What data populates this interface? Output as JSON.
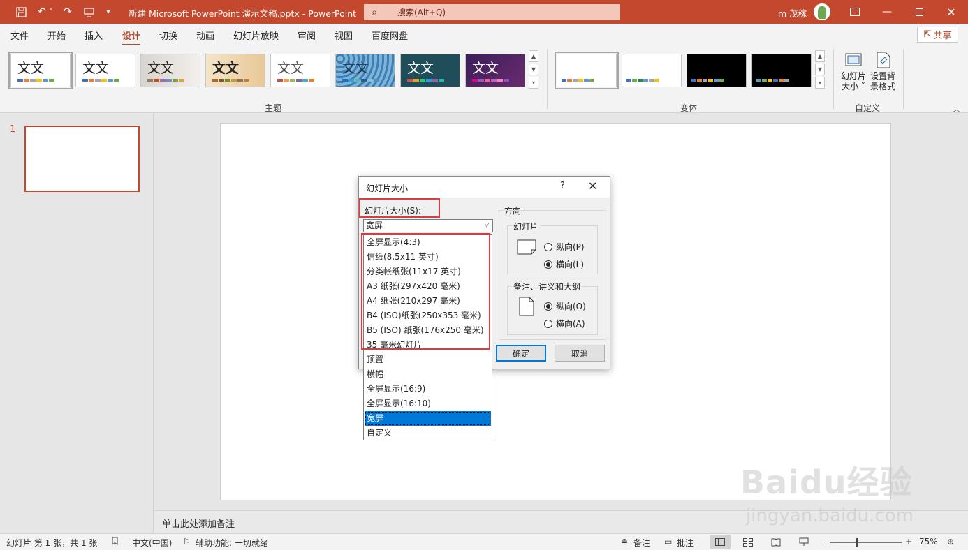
{
  "title_bar": {
    "doc_title": "新建 Microsoft PowerPoint 演示文稿.pptx  -  PowerPoint",
    "search_placeholder": "搜索(Alt+Q)",
    "user_name": "m 茂稼"
  },
  "ribbon_tabs": [
    "文件",
    "开始",
    "插入",
    "设计",
    "切换",
    "动画",
    "幻灯片放映",
    "审阅",
    "视图",
    "百度网盘"
  ],
  "active_tab": "设计",
  "share_label": "共享",
  "ribbon": {
    "themes_label": "主题",
    "variants_label": "变体",
    "customize_label": "自定义",
    "theme_text": "文文",
    "slide_size_btn": "幻灯片大小",
    "format_bg_btn": "设置背景格式",
    "slide_size_line1": "幻灯片",
    "slide_size_line2": "大小 ˅",
    "format_bg_line1": "设置背",
    "format_bg_line2": "景格式"
  },
  "thumbnails": {
    "slide_number": "1"
  },
  "notes_placeholder": "单击此处添加备注",
  "status_bar": {
    "slide_info": "幻灯片 第 1 张，共 1 张",
    "language": "中文(中国)",
    "accessibility": "辅助功能: 一切就绪",
    "notes_btn": "备注",
    "comments_btn": "批注",
    "zoom_minus": "-",
    "zoom_plus": "+",
    "zoom_level": "75%"
  },
  "dialog": {
    "title": "幻灯片大小",
    "help": "?",
    "close": "✕",
    "size_label": "幻灯片大小(S):",
    "size_value": "宽屏",
    "orientation_label": "方向",
    "slides_group": "幻灯片",
    "slides_portrait": "纵向(P)",
    "slides_landscape": "横向(L)",
    "notes_group": "备注、讲义和大纲",
    "notes_portrait": "纵向(O)",
    "notes_landscape": "横向(A)",
    "ok": "确定",
    "cancel": "取消"
  },
  "dropdown_items": [
    "全屏显示(4:3)",
    "信纸(8.5x11 英寸)",
    "分类帐纸张(11x17 英寸)",
    "A3 纸张(297x420 毫米)",
    "A4 纸张(210x297 毫米)",
    "B4 (ISO)纸张(250x353 毫米)",
    "B5 (ISO) 纸张(176x250 毫米)",
    "35 毫米幻灯片",
    "顶置",
    "横幅",
    "全屏显示(16:9)",
    "全屏显示(16:10)",
    "宽屏",
    "自定义"
  ],
  "selected_item": "宽屏",
  "watermark": "Baidu经验",
  "watermark_sub": "jingyan.baidu.com",
  "colors": {
    "accent": "#c4482d",
    "selection": "#0078d7",
    "highlight_box": "#e0393e"
  }
}
